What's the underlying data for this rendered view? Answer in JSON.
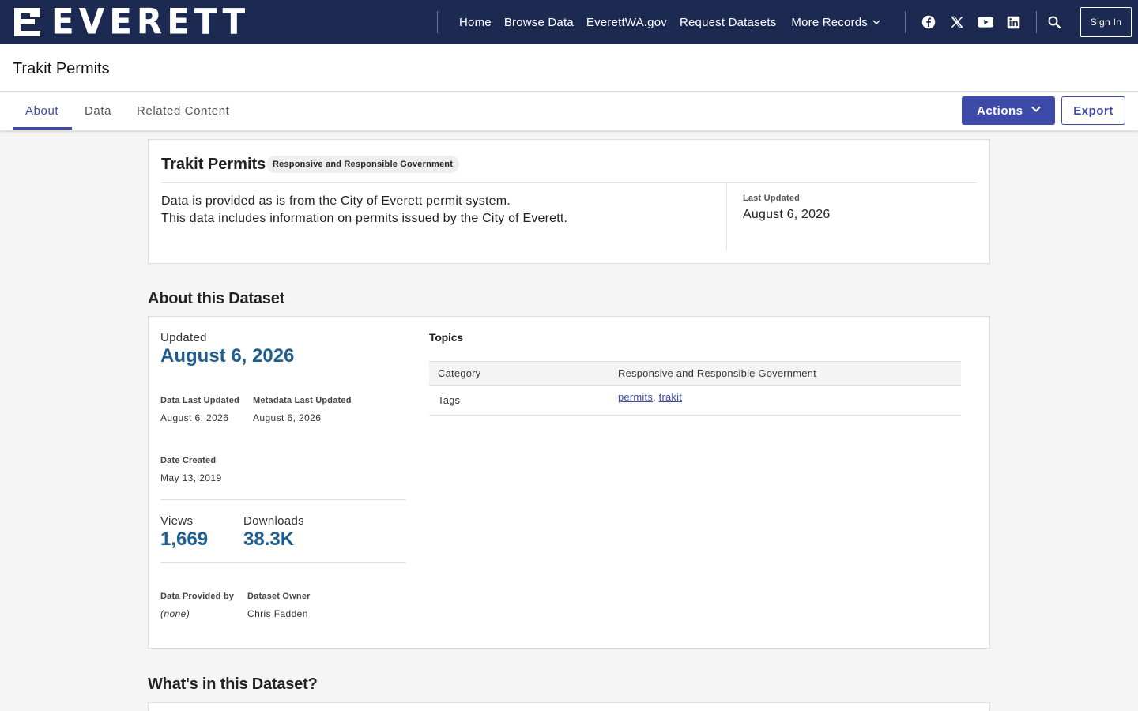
{
  "header": {
    "logo_text": "EVERETT",
    "nav": [
      {
        "label": "Home"
      },
      {
        "label": "Browse Data"
      },
      {
        "label": "EverettWA.gov"
      },
      {
        "label": "Request Datasets"
      },
      {
        "label": "More Records"
      }
    ],
    "social_icons": [
      "facebook-icon",
      "x-icon",
      "youtube-icon",
      "linkedin-icon"
    ],
    "sign_in_label": "Sign In",
    "colors": {
      "bar": "#1c2a52",
      "accent": "#3d4aa8",
      "stat": "#1f5f8f"
    }
  },
  "page": {
    "title": "Trakit Permits"
  },
  "tabs": {
    "items": [
      {
        "label": "About",
        "active": true
      },
      {
        "label": "Data",
        "active": false
      },
      {
        "label": "Related Content",
        "active": false
      }
    ],
    "actions_label": "Actions",
    "export_label": "Export"
  },
  "summary": {
    "title": "Trakit Permits",
    "badge": "Responsive and Responsible Government",
    "description_lines": [
      "Data is provided as is from the City of Everett permit system.",
      "This data includes information on permits issued by the City of Everett."
    ],
    "last_updated_label": "Last Updated",
    "last_updated_value": "August 6, 2026"
  },
  "about": {
    "heading": "About this Dataset",
    "updated_label": "Updated",
    "updated_value": "August 6, 2026",
    "data_last_updated_label": "Data Last Updated",
    "data_last_updated_value": "August 6, 2026",
    "metadata_last_updated_label": "Metadata Last Updated",
    "metadata_last_updated_value": "August 6, 2026",
    "date_created_label": "Date Created",
    "date_created_value": "May 13, 2019",
    "views_label": "Views",
    "views_value": "1,669",
    "downloads_label": "Downloads",
    "downloads_value": "38.3K",
    "provided_by_label": "Data Provided by",
    "provided_by_value": "(none)",
    "owner_label": "Dataset Owner",
    "owner_value": "Chris Fadden",
    "topics": {
      "title": "Topics",
      "category_label": "Category",
      "category_value": "Responsive and Responsible Government",
      "tags_label": "Tags",
      "tags": [
        "permits",
        "trakit"
      ],
      "tag_separator": ", "
    }
  },
  "whats": {
    "heading": "What's in this Dataset?"
  }
}
